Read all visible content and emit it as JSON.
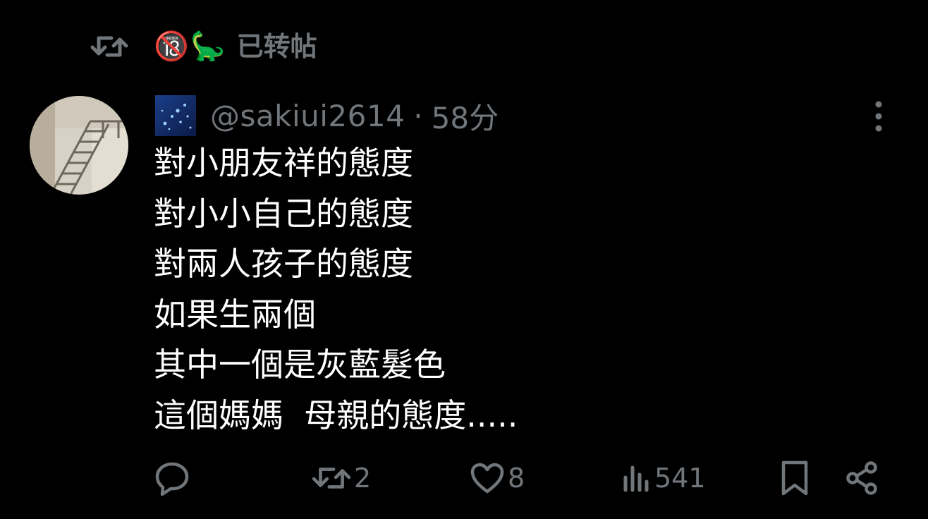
{
  "retweet_context": {
    "emoji": "🔞🦕",
    "label": "已转帖"
  },
  "post": {
    "handle": "@sakiui2614",
    "separator": "·",
    "time": "58分",
    "lines": [
      "對小朋友祥的態度",
      "對小小自己的態度",
      "對兩人孩子的態度",
      "如果生兩個",
      "其中一個是灰藍髮色",
      "這個媽媽  母親的態度....."
    ]
  },
  "actions": {
    "reply_count": "",
    "repost_count": "2",
    "like_count": "8",
    "views_count": "541"
  },
  "colors": {
    "background": "#000000",
    "text_primary": "#ffffff",
    "text_secondary": "#71767b"
  }
}
